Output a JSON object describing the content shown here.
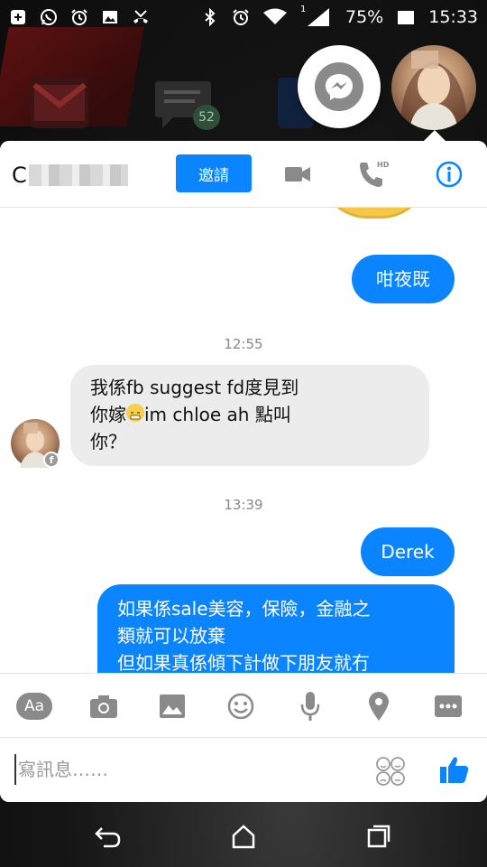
{
  "status_bar": {
    "battery": "75%",
    "time": "15:33",
    "signal_label": "1",
    "icons": [
      "add-notification-icon",
      "whatsapp-icon",
      "alarm-icon",
      "image-icon",
      "missed-call-icon",
      "bluetooth-icon",
      "alarm-clock-icon",
      "wifi-icon",
      "signal-icon",
      "battery-icon"
    ]
  },
  "background": {
    "unread_badge": "52"
  },
  "header": {
    "contact_initial": "C",
    "invite_label": "邀請",
    "hd_label": "HD"
  },
  "messages": [
    {
      "direction": "outgoing",
      "text": "咁夜既"
    },
    {
      "type": "timestamp",
      "text": "12:55"
    },
    {
      "direction": "incoming",
      "lines": [
        "我係fb suggest fd度見到",
        "你嫁",
        "im chloe ah 點叫",
        "你？"
      ]
    },
    {
      "type": "timestamp",
      "text": "13:39"
    },
    {
      "direction": "outgoing",
      "text": "Derek"
    },
    {
      "direction": "outgoing",
      "lines": [
        "如果係sale美容，保險，金融之",
        "類就可以放棄",
        "但如果真係傾下計做下朋友就冇"
      ]
    }
  ],
  "toolbar": {
    "text_button": "Aa"
  },
  "compose": {
    "placeholder": "寫訊息……"
  },
  "colors": {
    "accent": "#0a84ff",
    "incoming_bubble": "#ececec"
  }
}
